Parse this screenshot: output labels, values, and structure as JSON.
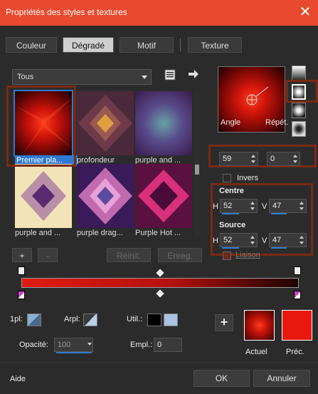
{
  "window": {
    "title": "Propriétés des styles et textures",
    "close_glyph": "✕"
  },
  "tabs": [
    {
      "label": "Couleur",
      "active": false
    },
    {
      "label": "Dégradé",
      "active": true
    },
    {
      "label": "Motif",
      "active": false
    },
    {
      "label": "Texture",
      "active": false
    }
  ],
  "library": {
    "category": "Tous",
    "items": [
      {
        "label": "Premier pla...",
        "selected": true
      },
      {
        "label": "profondeur",
        "selected": false
      },
      {
        "label": "purple and ...",
        "selected": false
      },
      {
        "label": "purple and ...",
        "selected": false
      },
      {
        "label": "purple drag...",
        "selected": false
      },
      {
        "label": "Purple Hot ...",
        "selected": false
      }
    ],
    "add_label": "+",
    "remove_label": "-",
    "reset_label": "Réinit.",
    "save_label": "Enreg."
  },
  "gradient": {
    "angle_label": "Angle",
    "angle_value": "59",
    "repeat_label": "Répét.",
    "repeat_value": "0",
    "invert_label": "Invers",
    "center_label": "Centre",
    "center_h_label": "H",
    "center_h_value": "52",
    "center_v_label": "V",
    "center_v_value": "47",
    "source_label": "Source",
    "source_h_label": "H",
    "source_h_value": "52",
    "source_v_label": "V",
    "source_v_value": "47",
    "link_label": "Liaison"
  },
  "stops": {
    "first_label": "1pl:",
    "background_label": "Arpl:",
    "user_label": "Util.:",
    "opacity_label": "Opacité:",
    "opacity_value": "100",
    "location_label": "Empl.:",
    "location_value": "0"
  },
  "swatches": {
    "add_label": "+",
    "current_label": "Actuel",
    "previous_label": "Préc.",
    "previous_color": "#e8180f"
  },
  "footer": {
    "help_label": "Aide",
    "ok_label": "OK",
    "cancel_label": "Annuler"
  },
  "colors": {
    "accent": "#2f7ad1",
    "titlebar": "#e8492f",
    "highlight": "#7a2a12"
  }
}
